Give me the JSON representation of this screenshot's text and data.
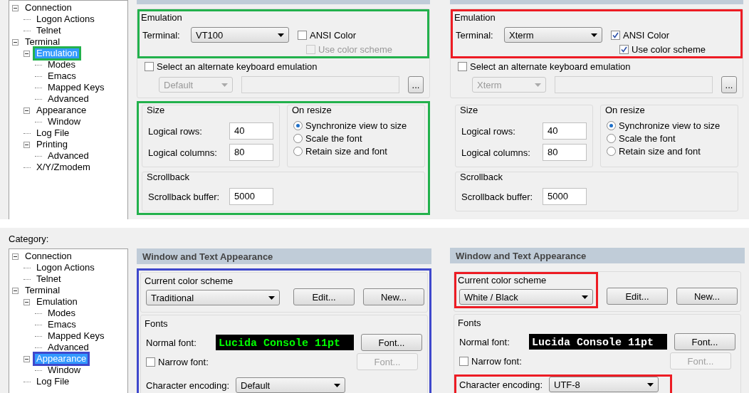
{
  "panels": [
    {
      "kind": "emulation",
      "color": "#22b14c",
      "tree_highlighted": true,
      "tree": [
        {
          "label": "Connection",
          "selected": false,
          "expanded": true,
          "children": [
            {
              "label": "Logon Actions",
              "selected": false
            },
            {
              "label": "Telnet",
              "selected": false
            }
          ]
        },
        {
          "label": "Terminal",
          "selected": false,
          "expanded": true,
          "children": [
            {
              "label": "Emulation",
              "selected": true,
              "expanded": true,
              "children": [
                {
                  "label": "Modes",
                  "selected": false
                },
                {
                  "label": "Emacs",
                  "selected": false
                },
                {
                  "label": "Mapped Keys",
                  "selected": false
                },
                {
                  "label": "Advanced",
                  "selected": false
                }
              ]
            },
            {
              "label": "Appearance",
              "selected": false,
              "expanded": true,
              "children": [
                {
                  "label": "Window",
                  "selected": false
                }
              ]
            },
            {
              "label": "Log File",
              "selected": false
            },
            {
              "label": "Printing",
              "selected": false,
              "expanded": true,
              "children": [
                {
                  "label": "Advanced",
                  "selected": false
                }
              ]
            },
            {
              "label": "X/Y/Zmodem",
              "selected": false
            }
          ]
        }
      ],
      "emulation": {
        "title": "Emulation",
        "highlighted": true,
        "terminal_label": "Terminal:",
        "terminal_value": "VT100",
        "ansi_color": {
          "label": "ANSI Color",
          "checked": false
        },
        "use_color_scheme": {
          "label": "Use color scheme",
          "checked": false,
          "disabled": true
        }
      },
      "alternate_keyboard": {
        "label": "Select an alternate keyboard emulation",
        "checked": false,
        "select_value": "Default",
        "browse_label": "..."
      },
      "lower_highlighted": true,
      "size": {
        "title": "Size",
        "rows_label": "Logical rows:",
        "rows": "40",
        "columns_label": "Logical columns:",
        "columns": "80"
      },
      "on_resize": {
        "title": "On resize",
        "options": [
          {
            "label": "Synchronize view to size",
            "selected": true
          },
          {
            "label": "Scale the font",
            "selected": false
          },
          {
            "label": "Retain size and font",
            "selected": false
          }
        ]
      },
      "scrollback": {
        "title": "Scrollback",
        "label": "Scrollback buffer:",
        "value": "5000"
      }
    },
    {
      "kind": "emulation",
      "color": "#ed1c24",
      "emulation": {
        "title": "Emulation",
        "highlighted": true,
        "terminal_label": "Terminal:",
        "terminal_value": "Xterm",
        "ansi_color": {
          "label": "ANSI Color",
          "checked": true
        },
        "use_color_scheme": {
          "label": "Use color scheme",
          "checked": true,
          "disabled": false
        }
      },
      "alternate_keyboard": {
        "label": "Select an alternate keyboard emulation",
        "checked": false,
        "select_value": "Xterm",
        "browse_label": "..."
      },
      "lower_highlighted": false,
      "size": {
        "title": "Size",
        "rows_label": "Logical rows:",
        "rows": "40",
        "columns_label": "Logical columns:",
        "columns": "80"
      },
      "on_resize": {
        "title": "On resize",
        "options": [
          {
            "label": "Synchronize view to size",
            "selected": true
          },
          {
            "label": "Scale the font",
            "selected": false
          },
          {
            "label": "Retain size and font",
            "selected": false
          }
        ]
      },
      "scrollback": {
        "title": "Scrollback",
        "label": "Scrollback buffer:",
        "value": "5000"
      }
    },
    {
      "kind": "appearance",
      "color": "#3f48cc",
      "tree_highlighted": true,
      "category_label": "Category:",
      "tree": [
        {
          "label": "Connection",
          "selected": false,
          "expanded": true,
          "children": [
            {
              "label": "Logon Actions",
              "selected": false
            },
            {
              "label": "Telnet",
              "selected": false
            }
          ]
        },
        {
          "label": "Terminal",
          "selected": false,
          "expanded": true,
          "children": [
            {
              "label": "Emulation",
              "selected": false,
              "expanded": true,
              "children": [
                {
                  "label": "Modes",
                  "selected": false
                },
                {
                  "label": "Emacs",
                  "selected": false
                },
                {
                  "label": "Mapped Keys",
                  "selected": false
                },
                {
                  "label": "Advanced",
                  "selected": false
                }
              ]
            },
            {
              "label": "Appearance",
              "selected": true,
              "expanded": true,
              "children": [
                {
                  "label": "Window",
                  "selected": false
                }
              ]
            },
            {
              "label": "Log File",
              "selected": false
            }
          ]
        }
      ],
      "header": "Window and Text Appearance",
      "body_highlighted": true,
      "color_scheme": {
        "title": "Current color scheme",
        "value": "Traditional",
        "highlighted": false,
        "edit": "Edit...",
        "new": "New..."
      },
      "fonts": {
        "title": "Fonts",
        "normal_label": "Normal font:",
        "preview": {
          "text": "Lucida Console 11pt",
          "color": "#00ff00"
        },
        "font_button": "Font...",
        "narrow": {
          "label": "Narrow font:",
          "checked": false
        },
        "narrow_button": {
          "label": "Font...",
          "disabled": true
        },
        "encoding_label": "Character encoding:",
        "encoding_value": "Default",
        "encoding_highlighted": false
      }
    },
    {
      "kind": "appearance",
      "color": "#ed1c24",
      "header": "Window and Text Appearance",
      "body_highlighted": false,
      "color_scheme": {
        "title": "Current color scheme",
        "value": "White / Black",
        "highlighted": true,
        "edit": "Edit...",
        "new": "New..."
      },
      "fonts": {
        "title": "Fonts",
        "normal_label": "Normal font:",
        "preview": {
          "text": "Lucida Console 11pt",
          "color": "#ffffff"
        },
        "font_button": "Font...",
        "narrow": {
          "label": "Narrow font:",
          "checked": false
        },
        "narrow_button": {
          "label": "Font...",
          "disabled": true
        },
        "encoding_label": "Character encoding:",
        "encoding_value": "UTF-8",
        "encoding_highlighted": true
      }
    }
  ]
}
